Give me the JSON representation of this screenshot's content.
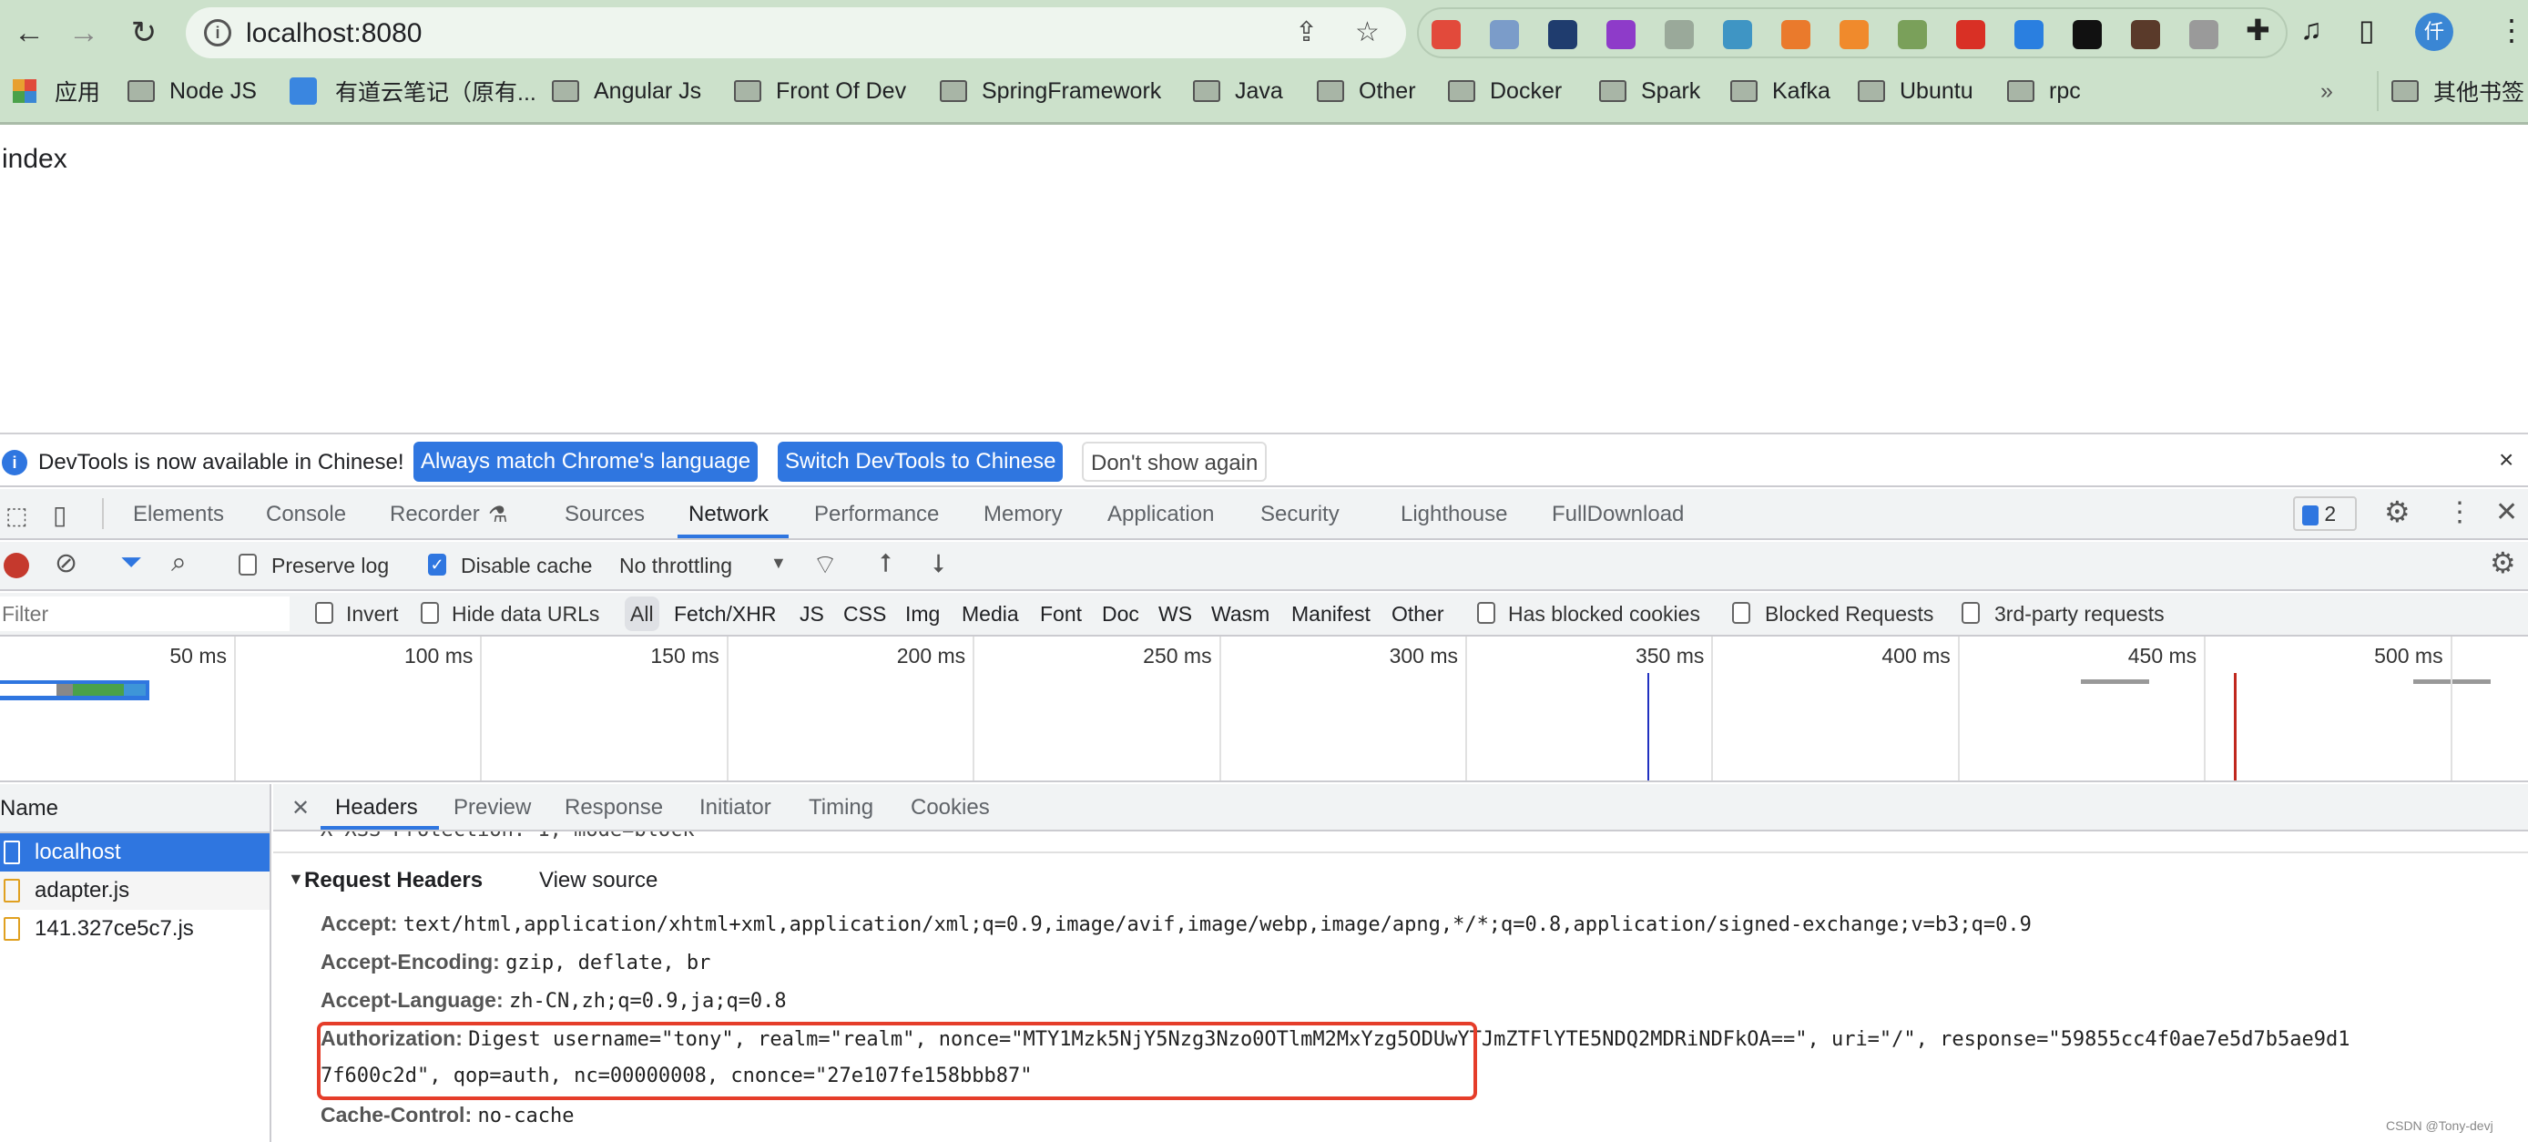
{
  "browser": {
    "url": "localhost:8080",
    "avatar_initial": "仟",
    "extensions": [
      {
        "name": "sitemap-ext",
        "color": "#e24a3b"
      },
      {
        "name": "ring-ext",
        "color": "#7b9cc9"
      },
      {
        "name": "check-ext",
        "color": "#1f3c6e"
      },
      {
        "name": "axure-rp-ext",
        "color": "#8e3bc9"
      },
      {
        "name": "react-devtools-ext",
        "color": "#9aa99a"
      },
      {
        "name": "fruit-bowl-ext",
        "color": "#3f95c4"
      },
      {
        "name": "orange-ext",
        "color": "#ea7a2c"
      },
      {
        "name": "orange-shape-ext",
        "color": "#f08a2c"
      },
      {
        "name": "download-ext",
        "color": "#7aa05a"
      },
      {
        "name": "fe-ext",
        "color": "#d93025"
      },
      {
        "name": "screen-ext",
        "color": "#2a7fe0"
      },
      {
        "name": "black-square-ext",
        "color": "#111111"
      },
      {
        "name": "mask-ext",
        "color": "#5a3a2a"
      },
      {
        "name": "command-ext",
        "color": "#9a9a9a"
      }
    ]
  },
  "bookmarks": {
    "items": [
      "应用",
      "Node JS",
      "有道云笔记（原有...",
      "Angular Js",
      "Front Of Dev",
      "SpringFramework",
      "Java",
      "Other",
      "Docker",
      "Spark",
      "Kafka",
      "Ubuntu",
      "rpc"
    ],
    "overflow": "»",
    "other": "其他书签"
  },
  "page": {
    "text": "index"
  },
  "infobar": {
    "message": "DevTools is now available in Chinese!",
    "btn_match": "Always match Chrome's language",
    "btn_switch": "Switch DevTools to Chinese",
    "btn_dismiss": "Don't show again",
    "close": "×"
  },
  "devtools": {
    "tabs": [
      "Elements",
      "Console",
      "Recorder",
      "Sources",
      "Network",
      "Performance",
      "Memory",
      "Application",
      "Security",
      "Lighthouse",
      "FullDownload"
    ],
    "active_tab": "Network",
    "issues_count": "2",
    "toolbar": {
      "preserve_log": "Preserve log",
      "disable_cache": "Disable cache",
      "throttling": "No throttling"
    },
    "filter": {
      "placeholder": "Filter",
      "invert": "Invert",
      "hide_data_urls": "Hide data URLs",
      "types": [
        "All",
        "Fetch/XHR",
        "JS",
        "CSS",
        "Img",
        "Media",
        "Font",
        "Doc",
        "WS",
        "Wasm",
        "Manifest",
        "Other"
      ],
      "has_blocked_cookies": "Has blocked cookies",
      "blocked_requests": "Blocked Requests",
      "third_party": "3rd-party requests"
    },
    "timeline": {
      "ticks": [
        "50 ms",
        "100 ms",
        "150 ms",
        "200 ms",
        "250 ms",
        "300 ms",
        "350 ms",
        "400 ms",
        "450 ms",
        "500 ms"
      ],
      "dom_content_loaded_ms": 337,
      "load_ms": 456
    },
    "requests": {
      "header": "Name",
      "items": [
        "localhost",
        "adapter.js",
        "141.327ce5c7.js"
      ],
      "selected": 0
    },
    "detail": {
      "tabs": [
        "Headers",
        "Preview",
        "Response",
        "Initiator",
        "Timing",
        "Cookies"
      ],
      "active": "Headers",
      "partial_line": "X-XSS-Protection: 1; mode=block",
      "section": "Request Headers",
      "view_source": "View source",
      "headers": [
        {
          "name": "Accept:",
          "value": "text/html,application/xhtml+xml,application/xml;q=0.9,image/avif,image/webp,image/apng,*/*;q=0.8,application/signed-exchange;v=b3;q=0.9"
        },
        {
          "name": "Accept-Encoding:",
          "value": "gzip, deflate, br"
        },
        {
          "name": "Accept-Language:",
          "value": "zh-CN,zh;q=0.9,ja;q=0.8"
        },
        {
          "name": "Authorization:",
          "value": "Digest username=\"tony\", realm=\"realm\", nonce=\"MTY1Mzk5NjY5Nzg3Nzo0OTlmM2MxYzg5ODUwYTJmZTFlYTE5NDQ2MDRiNDFkOA==\", uri=\"/\", response=\"59855cc4f0ae7e5d7b5ae9d1",
          "value2": "7f600c2d\", qop=auth, nc=00000008, cnonce=\"27e107fe158bbb87\""
        },
        {
          "name": "Cache-Control:",
          "value": "no-cache"
        }
      ]
    }
  },
  "watermark": "CSDN @Tony-devj"
}
